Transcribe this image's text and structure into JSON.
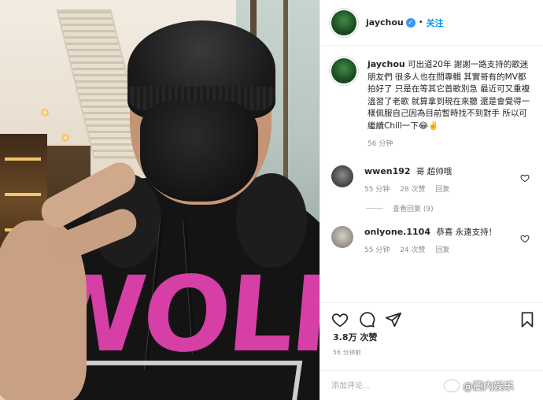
{
  "header": {
    "username": "jaychou",
    "follow_label": "关注"
  },
  "post": {
    "username": "jaychou",
    "caption": "可出道20年 謝謝一路支持的歌迷朋友們 很多人也在問專輯 其實哥有的MV都拍好了 只是在等其它首歌別急 最近可又重複溫習了老歌 就算拿到現在來聽 還是會覺得一樣佩服自己因為目前暫時找不到對手 所以可繼續Chill一下😂✌️",
    "time": "56 分钟"
  },
  "comments": [
    {
      "username": "wwen192",
      "text": "哥 超帅哦",
      "time": "55 分钟",
      "likes": "28 次赞",
      "reply_label": "回复"
    },
    {
      "username": "onlyone.1104",
      "text": "恭喜 永遠支持！",
      "time": "55 分钟",
      "likes": "24 次赞",
      "reply_label": "回复"
    }
  ],
  "view_replies_label": "查看回复 (9)",
  "likes_count": "3.8万 次赞",
  "post_time": "56 分钟前",
  "add_comment_placeholder": "添加评论...",
  "watermark": "@圈内娱乐",
  "icons": {
    "like": "heart-icon",
    "comment": "comment-icon",
    "share": "paper-plane-icon",
    "save": "bookmark-icon",
    "verified": "verified-badge-icon"
  },
  "colors": {
    "accent": "#0095f6",
    "verified": "#3897f0",
    "hoodie_print": "#d63fa6"
  }
}
